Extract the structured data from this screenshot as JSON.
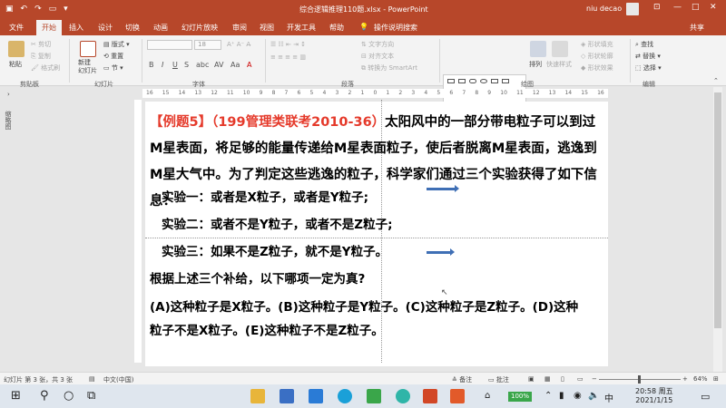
{
  "window": {
    "title": "综合逻辑推理110题.xlsx  -  PowerPoint",
    "user": "niu decao",
    "share": "共享"
  },
  "tabs": [
    "文件",
    "开始",
    "插入",
    "设计",
    "切换",
    "动画",
    "幻灯片放映",
    "审阅",
    "视图",
    "开发工具",
    "帮助"
  ],
  "active_tab": "开始",
  "tell_me": "操作说明搜索",
  "ribbon": {
    "clipboard": {
      "paste": "粘贴",
      "cut": "剪切",
      "copy": "复制",
      "format_painter": "格式刷",
      "label": "剪贴板"
    },
    "slides": {
      "new_slide": "新建\n幻灯片",
      "layout": "版式",
      "reset": "重置",
      "section": "节",
      "label": "幻灯片"
    },
    "font": {
      "font_size": "18",
      "label": "字体"
    },
    "paragraph": {
      "text_direction": "文字方向",
      "align_text": "对齐文本",
      "smartart": "转换为 SmartArt",
      "label": "段落"
    },
    "drawing": {
      "arrange": "排列",
      "quick_styles": "快速样式",
      "shape_fill": "形状填充",
      "shape_outline": "形状轮廓",
      "shape_effects": "形状效果",
      "label": "绘图"
    },
    "editing": {
      "find": "查找",
      "replace": "替换",
      "select": "选择",
      "label": "编辑"
    }
  },
  "left_panel_label": "缩略图",
  "ruler_labels": [
    "16",
    "15",
    "14",
    "13",
    "12",
    "11",
    "10",
    "9",
    "8",
    "7",
    "6",
    "5",
    "4",
    "3",
    "2",
    "1",
    "0",
    "1",
    "2",
    "3",
    "4",
    "5",
    "6",
    "7",
    "8",
    "9",
    "10",
    "11",
    "12",
    "13",
    "14",
    "15",
    "16"
  ],
  "slide": {
    "example_label": "【例题5】",
    "source": "（199管理类联考2010-36）",
    "intro_rest": "太阳风中的一部分带电粒子可以到过M星表面，将足够的能量传递给M星表面粒子，使后者脱离M星表面，逃逸到M星大气中。为了判定这些逃逸的粒子，科学家们通过三个实验获得了如下信息：",
    "experiments": [
      "实验一：或者是X粒子，或者是Y粒子;",
      "实验二：或者不是Y粒子，或者不是Z粒子;",
      "实验三：如果不是Z粒子，就不是Y粒子。"
    ],
    "question": "根据上述三个补给，以下哪项一定为真?",
    "options_line1": "(A)这种粒子是X粒子。(B)这种粒子是Y粒子。(C)这种粒子是Z粒子。(D)这种",
    "options_line2": "粒子不是X粒子。(E)这种粒子不是Z粒子。"
  },
  "status": {
    "slide_count": "幻灯片 第 3 张，共 3 张",
    "language": "中文(中国)",
    "notes": "备注",
    "comments": "批注",
    "zoom": "64%"
  },
  "taskbar": {
    "battery": "100%",
    "time": "20:58 周五",
    "date": "2021/1/15"
  },
  "colors": {
    "accent": "#b7472a",
    "title_red": "#e53a2b",
    "arrow_blue": "#3f6fb5"
  }
}
